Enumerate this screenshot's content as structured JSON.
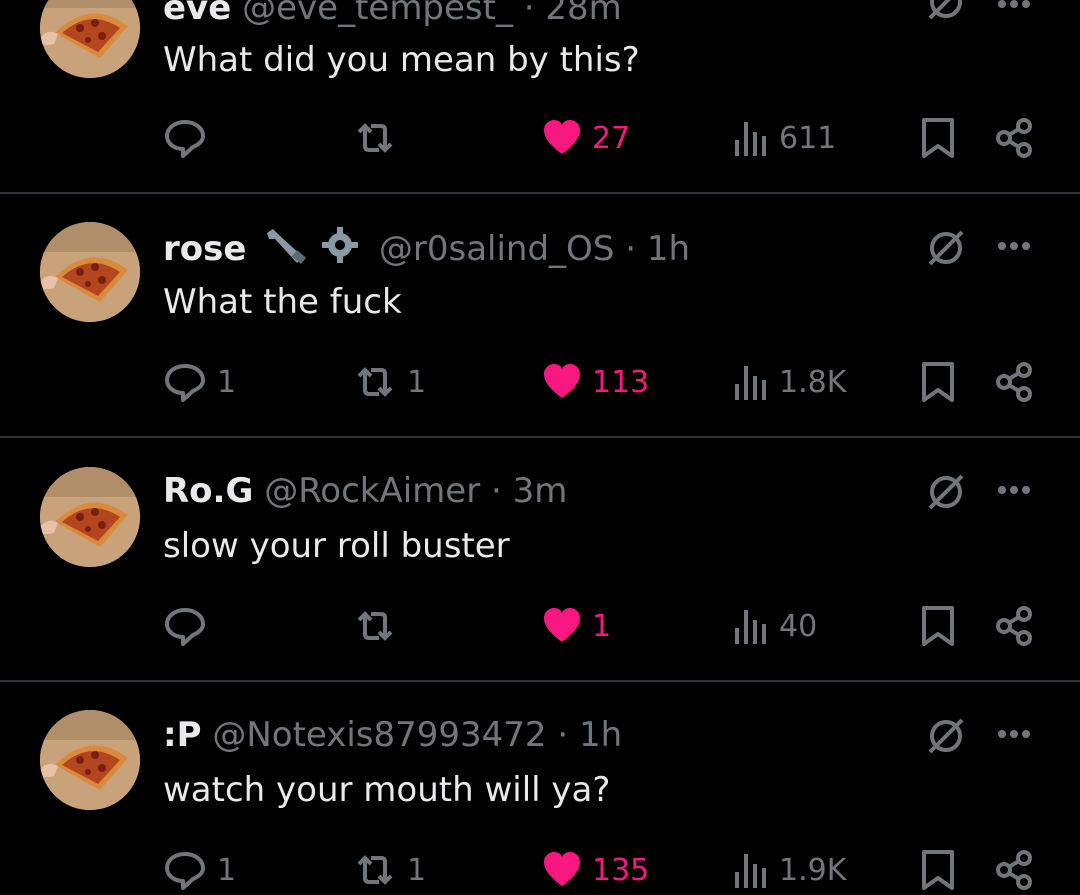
{
  "posts": [
    {
      "name": "eve",
      "handle": "@eve_tempest_",
      "time": "28m",
      "text": "What did you mean by this?",
      "replies": "",
      "reposts": "",
      "likes": "27",
      "views": "611",
      "liked": true
    },
    {
      "name": "rose",
      "handle": "@r0salind_OS",
      "time": "1h",
      "text": "What the fuck",
      "replies": "1",
      "reposts": "1",
      "likes": "113",
      "views": "1.8K",
      "liked": true,
      "badges": [
        "wrench-icon",
        "gear-icon"
      ]
    },
    {
      "name": "Ro.G",
      "handle": "@RockAimer",
      "time": "3m",
      "text": "slow your roll buster",
      "replies": "",
      "reposts": "",
      "likes": "1",
      "views": "40",
      "liked": true
    },
    {
      "name": ":P",
      "handle": "@Notexis87993472",
      "time": "1h",
      "text": "watch your mouth will ya?",
      "replies": "1",
      "reposts": "1",
      "likes": "135",
      "views": "1.9K",
      "liked": true
    }
  ],
  "separator": "·",
  "colors": {
    "background": "#000000",
    "text": "#e7e9ea",
    "muted": "#71767b",
    "like": "#f91880",
    "divider": "#2f3336"
  }
}
